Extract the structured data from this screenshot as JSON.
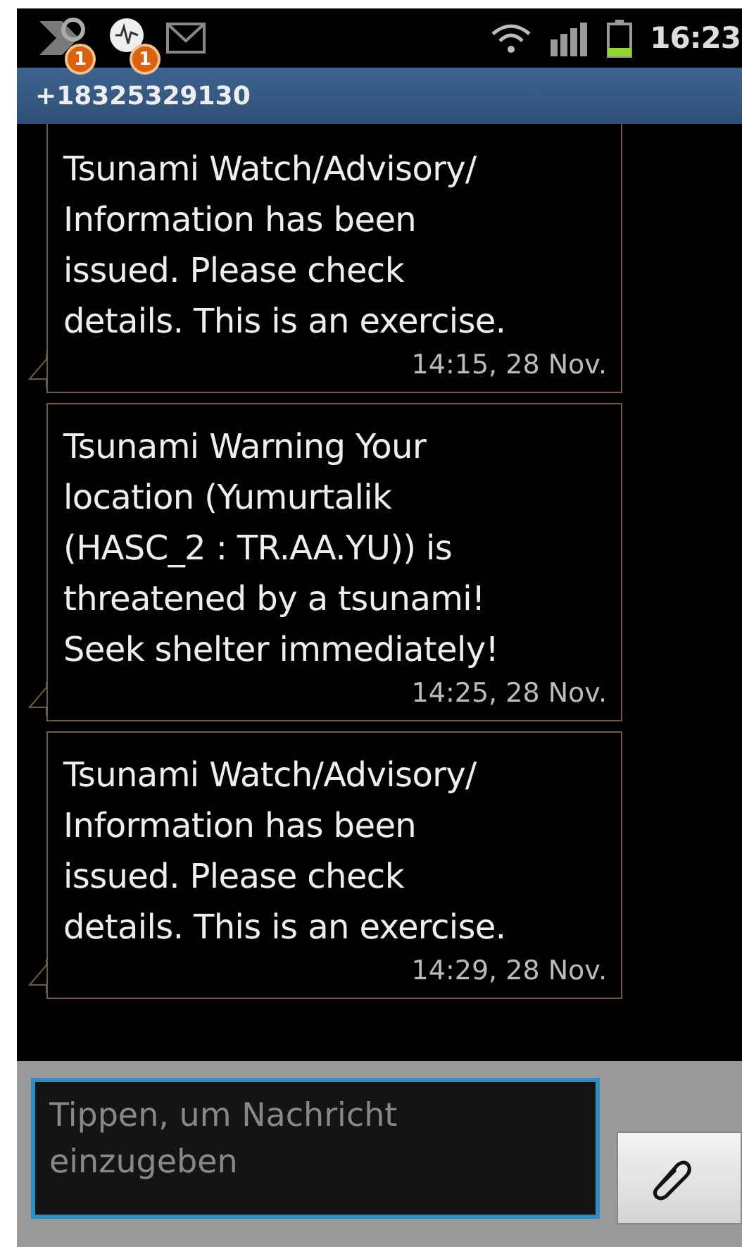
{
  "status_bar": {
    "notifications": [
      {
        "kind": "missed-call",
        "badge": "1"
      },
      {
        "kind": "voicemail",
        "badge": "1"
      },
      {
        "kind": "mail"
      }
    ],
    "time": "16:23"
  },
  "title_bar": {
    "title": "+18325329130"
  },
  "messages": [
    {
      "lines": [
        "Tsunami Watch/Advisory/",
        "Information has been",
        "issued. Please check",
        "details. This is an exercise."
      ],
      "time": "14:15, 28 Nov."
    },
    {
      "lines": [
        "Tsunami Warning Your",
        "location (Yumurtalik",
        "(HASC_2 : TR.AA.YU)) is",
        "threatened by a tsunami!",
        "Seek shelter immediately!"
      ],
      "time": "14:25, 28 Nov."
    },
    {
      "lines": [
        "Tsunami Watch/Advisory/",
        "Information has been",
        "issued. Please check",
        "details. This is an exercise."
      ],
      "time": "14:29, 28 Nov."
    }
  ],
  "composer": {
    "placeholder": "Tippen, um Nachricht einzugeben"
  }
}
